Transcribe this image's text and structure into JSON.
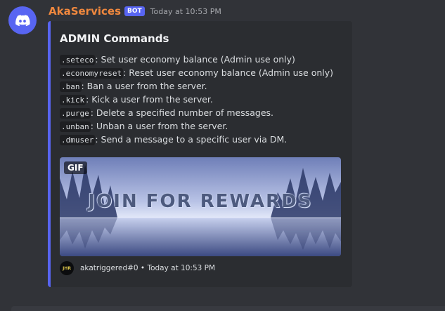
{
  "message": {
    "username": "AkaServices",
    "bot_tag": "BOT",
    "timestamp": "Today at 10:53 PM",
    "avatar_icon": "discord-logo-icon"
  },
  "embed": {
    "accent_color": "#5865f2",
    "title": "ADMIN Commands",
    "commands": [
      {
        "code": ".seteco",
        "description": ": Set user economy balance (Admin use only)"
      },
      {
        "code": ".economyreset",
        "description": ": Reset user economy balance (Admin use only)"
      },
      {
        "code": ".ban",
        "description": ": Ban a user from the server."
      },
      {
        "code": ".kick",
        "description": ": Kick a user from the server."
      },
      {
        "code": ".purge",
        "description": ": Delete a specified number of messages."
      },
      {
        "code": ".unban",
        "description": ": Unban a user from the server."
      },
      {
        "code": ".dmuser",
        "description": ": Send a message to a specific user via DM."
      }
    ],
    "image": {
      "badge": "GIF",
      "text": "JOIN FOR REWARDS"
    },
    "footer": {
      "icon_text": "JHR",
      "text": "akatriggered#0 • Today at 10:53 PM"
    }
  }
}
